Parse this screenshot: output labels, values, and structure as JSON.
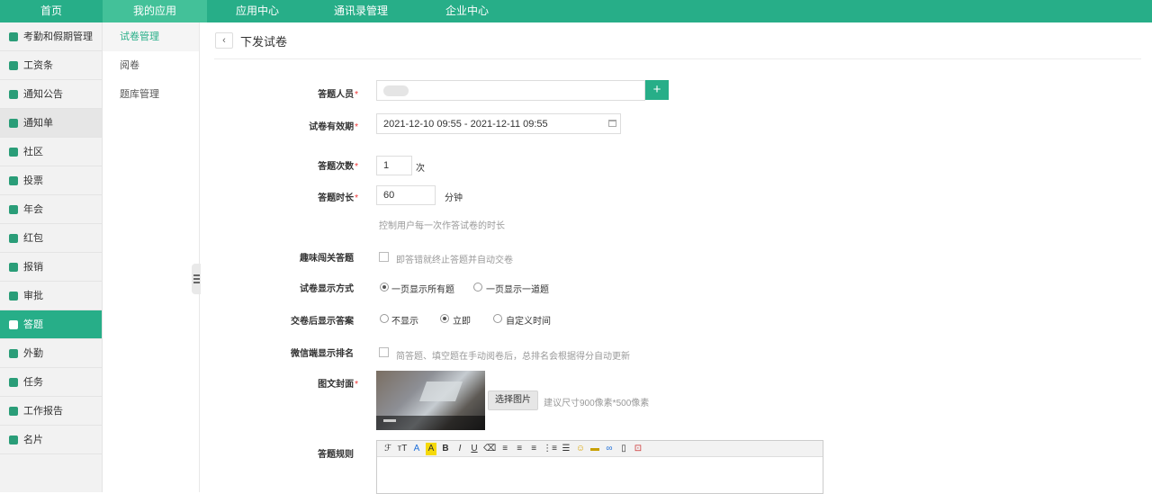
{
  "topnav": [
    "首页",
    "我的应用",
    "应用中心",
    "通讯录管理",
    "企业中心"
  ],
  "sidebar": [
    "考勤和假期管理",
    "工资条",
    "通知公告",
    "通知单",
    "社区",
    "投票",
    "年会",
    "红包",
    "报销",
    "审批",
    "答题",
    "外勤",
    "任务",
    "工作报告",
    "名片"
  ],
  "subsidebar": [
    "试卷管理",
    "阅卷",
    "题库管理"
  ],
  "page": {
    "back_icon": "‹",
    "title": "下发试卷"
  },
  "form": {
    "respondents_label": "答题人员",
    "add_symbol": "+",
    "validity_label": "试卷有效期",
    "validity_value": "2021-12-10 09:55 - 2021-12-11 09:55",
    "attempts_label": "答题次数",
    "attempts_value": "1",
    "attempts_unit": "次",
    "duration_label": "答题时长",
    "duration_value": "60",
    "duration_unit": "分钟",
    "duration_hint": "控制用户每一次作答试卷的时长",
    "fun_label": "趣味闯关答题",
    "fun_option": "即答错就终止答题并自动交卷",
    "display_label": "试卷显示方式",
    "display_opt1": "一页显示所有题",
    "display_opt2": "一页显示一道题",
    "answer_label": "交卷后显示答案",
    "answer_opt1": "不显示",
    "answer_opt2": "立即",
    "answer_opt3": "自定义时间",
    "rank_label": "微信端显示排名",
    "rank_option": "简答题、填空题在手动阅卷后，总排名会根据得分自动更新",
    "cover_label": "图文封面",
    "choose_image": "选择图片",
    "cover_hint": "建议尺寸900像素*500像素",
    "rules_label": "答题规则",
    "required_mark": "*"
  },
  "editor_toolbar": [
    "ℱ",
    "тT",
    "A",
    "A",
    "B",
    "I",
    "U",
    "⌫",
    "≡",
    "≡",
    "≡",
    "⋮≡",
    "☰",
    "☺",
    "▬",
    "∞",
    "▯",
    "⊡"
  ]
}
